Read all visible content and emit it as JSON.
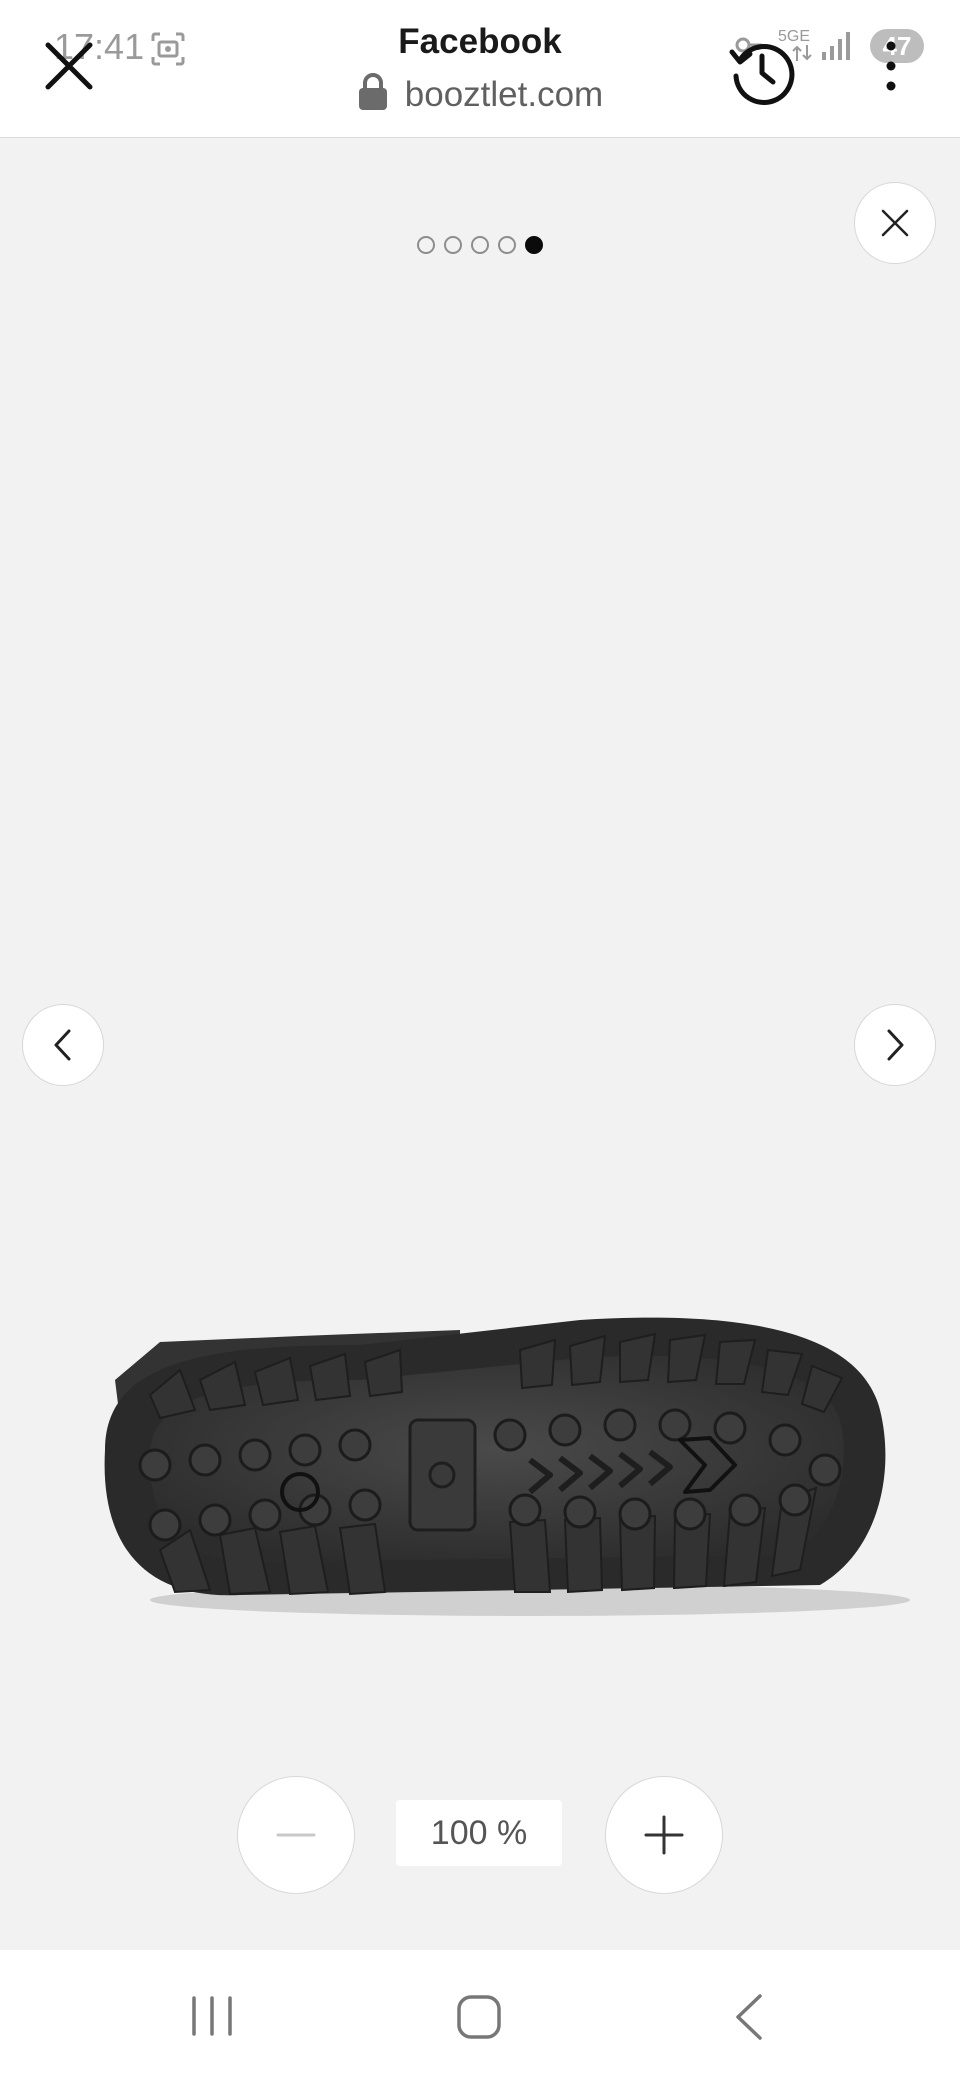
{
  "status_bar": {
    "time": "17:41",
    "network": "5GE",
    "battery": "47"
  },
  "browser": {
    "title": "Facebook",
    "url": "booztlet.com"
  },
  "gallery": {
    "image_count": 5,
    "active_index": 5,
    "image_subject": "sole of black winter boot"
  },
  "zoom": {
    "level": "100 %"
  },
  "icons": {
    "close": "close-icon",
    "history": "history-icon",
    "more": "more-vertical-icon",
    "lock": "lock-icon",
    "prev": "chevron-left-icon",
    "next": "chevron-right-icon",
    "zoom_out": "minus-icon",
    "zoom_in": "plus-icon",
    "nav_recents": "recents-icon",
    "nav_home": "home-icon",
    "nav_back": "back-icon"
  },
  "colors": {
    "viewer_background": "#f2f2f2",
    "active_dot": "#0b0b0b",
    "inactive_dot": "#8d8d8d"
  }
}
